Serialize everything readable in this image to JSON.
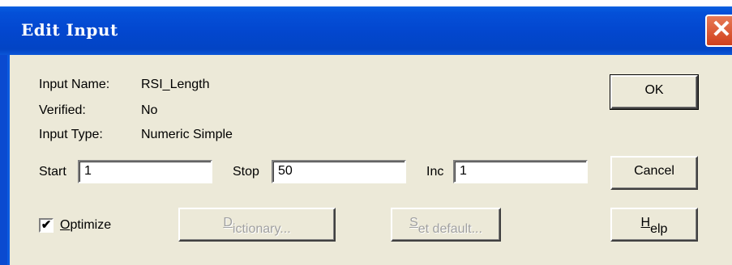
{
  "window": {
    "title": "Edit Input",
    "close_glyph": "✕"
  },
  "info": {
    "input_name_label": "Input Name:",
    "input_name_value": "RSI_Length",
    "verified_label": "Verified:",
    "verified_value": "No",
    "input_type_label": "Input Type:",
    "input_type_value": "Numeric Simple"
  },
  "range": {
    "start_label": "Start",
    "start_value": "1",
    "stop_label": "Stop",
    "stop_value": "50",
    "inc_label": "Inc",
    "inc_value": "1"
  },
  "optimize": {
    "label_first": "O",
    "label_rest": "ptimize",
    "checked": true,
    "check_glyph": "✔"
  },
  "buttons": {
    "ok": "OK",
    "cancel": "Cancel",
    "help_first": "H",
    "help_rest": "elp",
    "dictionary_first": "D",
    "dictionary_rest": "ictionary...",
    "set_default_first": "S",
    "set_default_rest": "et default..."
  }
}
